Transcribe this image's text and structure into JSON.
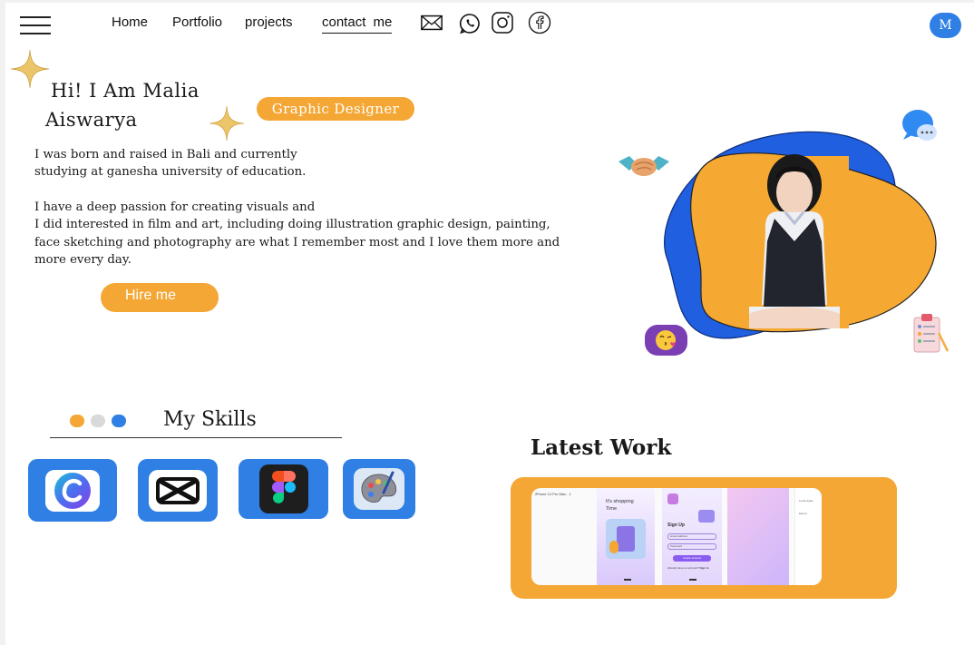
{
  "nav": {
    "links": [
      "Home",
      "Portfolio",
      "projects",
      "contact  me"
    ]
  },
  "avatar": {
    "initial": "M"
  },
  "hero": {
    "name_line1": "Hi! I Am Malia",
    "name_line2": "Aiswarya",
    "role": "Graphic Designer",
    "bio_lines": [
      "I was born and raised in Bali and currently",
      "studying at ganesha university of education.",
      "I have a deep passion for creating visuals and",
      "I did interested in film and art, including doing illustration graphic design, painting,",
      "face sketching and photography are what I remember most and I love them more and",
      "more every day."
    ],
    "cta": "Hire me"
  },
  "skills": {
    "title": "My Skills",
    "tools": [
      {
        "icon": "canva-icon"
      },
      {
        "icon": "capcut-icon"
      },
      {
        "icon": "figma-icon"
      },
      {
        "icon": "paint-palette-icon"
      }
    ]
  },
  "latest": {
    "title": "Latest Work",
    "preview": {
      "device": "iPhone 14 Pro Max - 1",
      "screen1_title": "It's shopping",
      "screen1_sub": "Time",
      "screen2_title": "Sign Up",
      "screen2_email": "Email address",
      "screen2_password": "Password",
      "screen2_button": "Create account",
      "screen2_footer": "Already have an account?",
      "screen2_footer_link": "Sign in",
      "side_item1": "Local styles",
      "side_item2": "Export"
    }
  },
  "colors": {
    "accent_orange": "#f4a735",
    "accent_blue": "#2f7fe5",
    "blob_blue": "#1f5fe0",
    "dot_gray": "#d9d9d9"
  }
}
